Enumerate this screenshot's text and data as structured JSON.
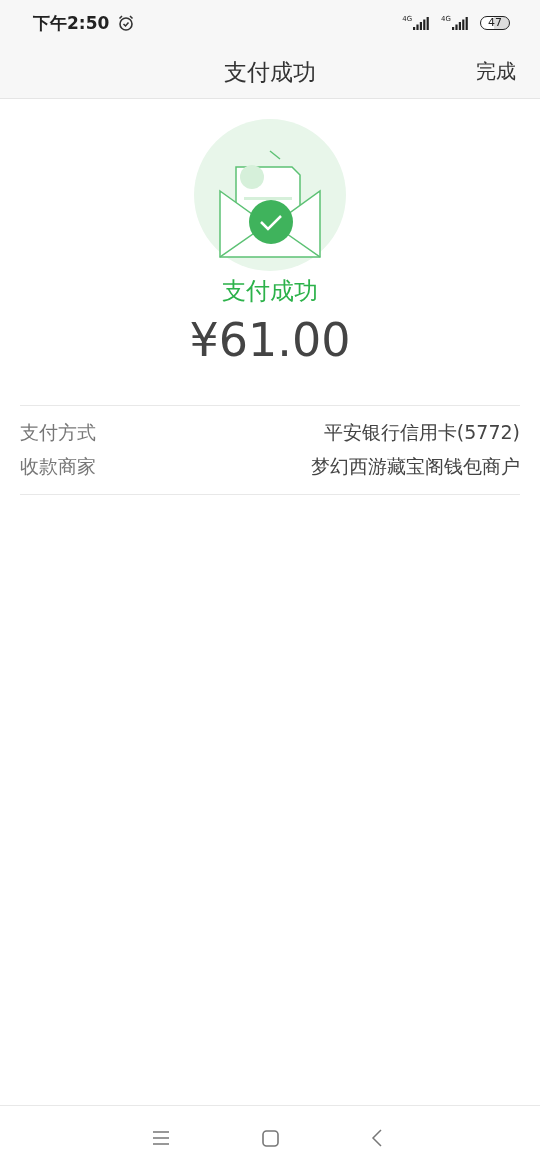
{
  "status_bar": {
    "time": "下午2:50",
    "signals": [
      "4G",
      "4G"
    ],
    "battery": "47"
  },
  "nav_bar": {
    "title": "支付成功",
    "action": "完成"
  },
  "result": {
    "status": "支付成功",
    "amount": "¥61.00"
  },
  "details": [
    {
      "label": "支付方式",
      "value": "平安银行信用卡(5772)"
    },
    {
      "label": "收款商家",
      "value": "梦幻西游藏宝阁钱包商户"
    }
  ]
}
